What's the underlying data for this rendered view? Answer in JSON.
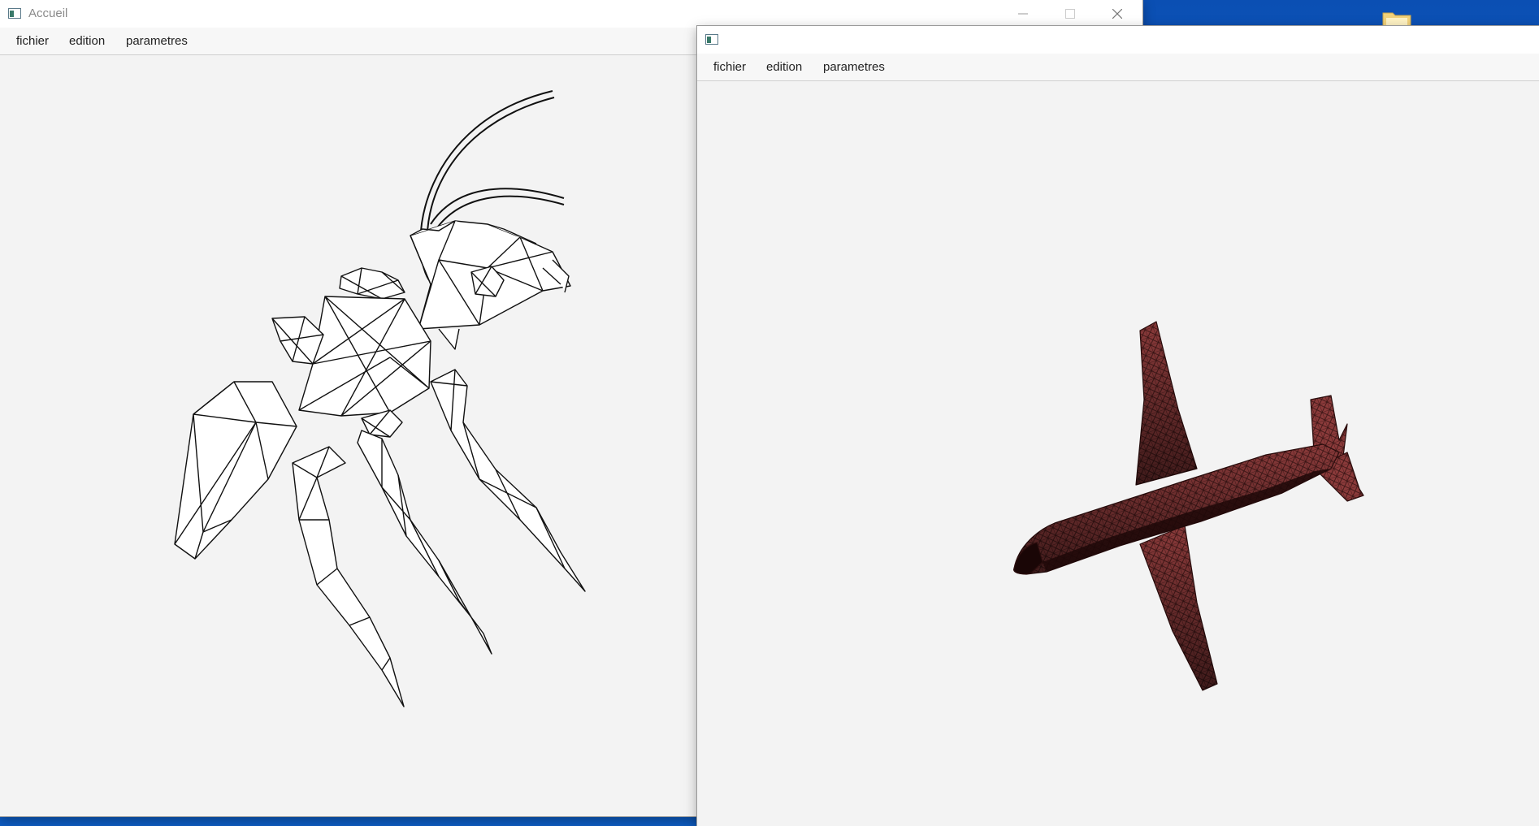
{
  "desktop": {
    "folder_icon": "folder-icon"
  },
  "windows": {
    "left": {
      "title": "Accueil",
      "icon": "java-app-icon",
      "controls": [
        "minimize-icon",
        "maximize-icon",
        "close-icon"
      ],
      "menu": [
        "fichier",
        "edition",
        "parametres"
      ],
      "model": "wireframe-ant"
    },
    "right": {
      "title": "",
      "icon": "java-app-icon",
      "menu": [
        "fichier",
        "edition",
        "parametres"
      ],
      "model": "shaded-airplane",
      "model_color": "#8a3a3a"
    }
  }
}
